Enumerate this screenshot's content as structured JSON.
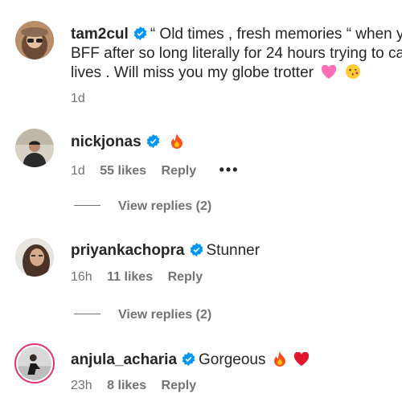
{
  "comments": [
    {
      "username": "tam2cul",
      "lines": [
        "“ Old times , fresh memories “ when y",
        "BFF after so long literally for 24 hours trying to ca",
        "lives . Will miss you my globe trotter"
      ],
      "time": "1d"
    },
    {
      "username": "nickjonas",
      "text": "",
      "time": "1d",
      "likes": "55 likes",
      "reply": "Reply",
      "more": "•••"
    },
    {
      "username": "priyankachopra",
      "text": "Stunner",
      "time": "16h",
      "likes": "11 likes",
      "reply": "Reply"
    },
    {
      "username": "anjula_acharia",
      "text": "Gorgeous",
      "time": "23h",
      "likes": "8 likes",
      "reply": "Reply"
    }
  ],
  "view_replies": [
    "View replies (2)",
    "View replies (2)"
  ],
  "colors": {
    "verified": "#0095f6",
    "muted": "#737373",
    "text": "#262626"
  },
  "icons": [
    "verified-badge-icon",
    "fire-emoji-icon",
    "heart-emoji-icon",
    "kiss-emoji-icon",
    "red-heart-emoji-icon"
  ]
}
